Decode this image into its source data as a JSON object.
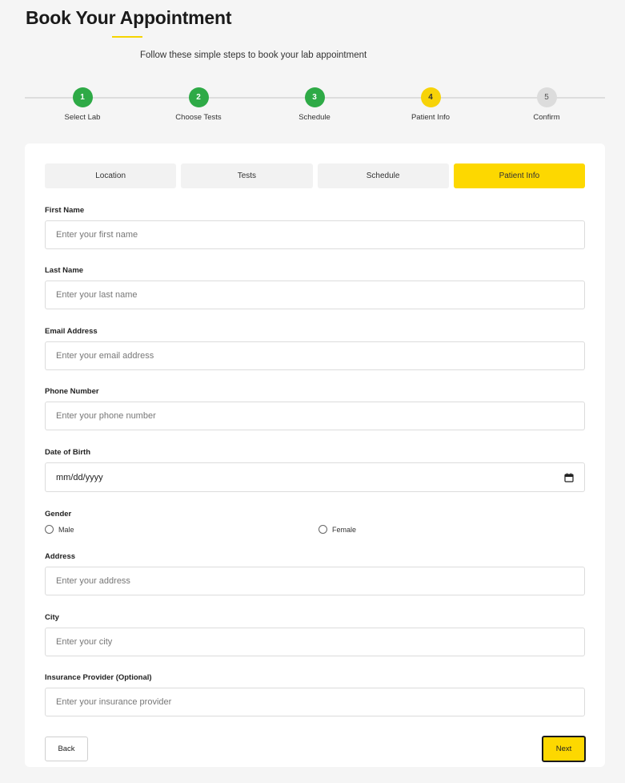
{
  "header": {
    "title": "Book Your Appointment",
    "subtitle": "Follow these simple steps to book your lab appointment"
  },
  "stepper": {
    "steps": [
      {
        "number": "1",
        "label": "Select Lab",
        "state": "done"
      },
      {
        "number": "2",
        "label": "Choose Tests",
        "state": "done"
      },
      {
        "number": "3",
        "label": "Schedule",
        "state": "done"
      },
      {
        "number": "4",
        "label": "Patient Info",
        "state": "active"
      },
      {
        "number": "5",
        "label": "Confirm",
        "state": "pending"
      }
    ]
  },
  "tabs": [
    {
      "label": "Location",
      "active": false
    },
    {
      "label": "Tests",
      "active": false
    },
    {
      "label": "Schedule",
      "active": false
    },
    {
      "label": "Patient Info",
      "active": true
    }
  ],
  "form": {
    "first_name": {
      "label": "First Name",
      "placeholder": "Enter your first name"
    },
    "last_name": {
      "label": "Last Name",
      "placeholder": "Enter your last name"
    },
    "email": {
      "label": "Email Address",
      "placeholder": "Enter your email address"
    },
    "phone": {
      "label": "Phone Number",
      "placeholder": "Enter your phone number"
    },
    "dob": {
      "label": "Date of Birth",
      "value": "mm/dd/yyyy"
    },
    "gender": {
      "label": "Gender",
      "options": [
        "Male",
        "Female"
      ]
    },
    "address": {
      "label": "Address",
      "placeholder": "Enter your address"
    },
    "city": {
      "label": "City",
      "placeholder": "Enter your city"
    },
    "insurance": {
      "label": "Insurance Provider (Optional)",
      "placeholder": "Enter your insurance provider"
    }
  },
  "actions": {
    "back_label": "Back",
    "next_label": "Next"
  },
  "colors": {
    "accent": "#fdd800",
    "done": "#2eaa46"
  },
  "icons": {
    "date": "calendar-icon"
  }
}
